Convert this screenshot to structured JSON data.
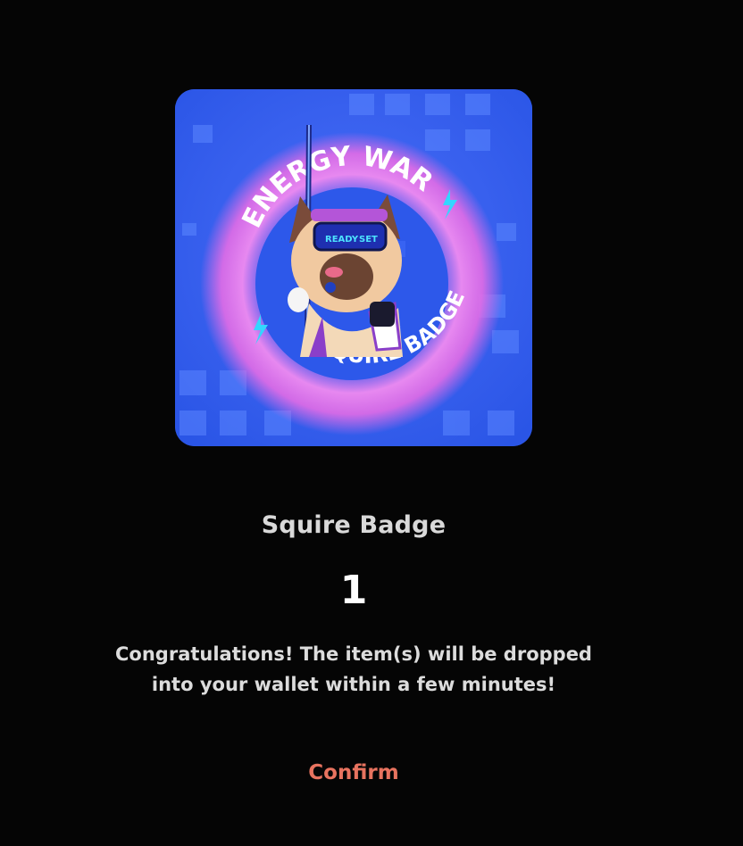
{
  "modal": {
    "badge_image": {
      "ring_text_top": "ENERGY WAR",
      "ring_text_bottom": "SQUIRE BADGE",
      "goggles_left": "READY",
      "goggles_right": "SET"
    },
    "item_name": "Squire Badge",
    "quantity": "1",
    "message_line1": "Congratulations! The item(s) will be dropped",
    "message_line2": "into your wallet within a few minutes!",
    "confirm_label": "Confirm"
  },
  "colors": {
    "background": "#050505",
    "badge_blue": "#2f63f0",
    "ring_pink": "#e36ce6",
    "confirm_text": "#e8735f"
  }
}
